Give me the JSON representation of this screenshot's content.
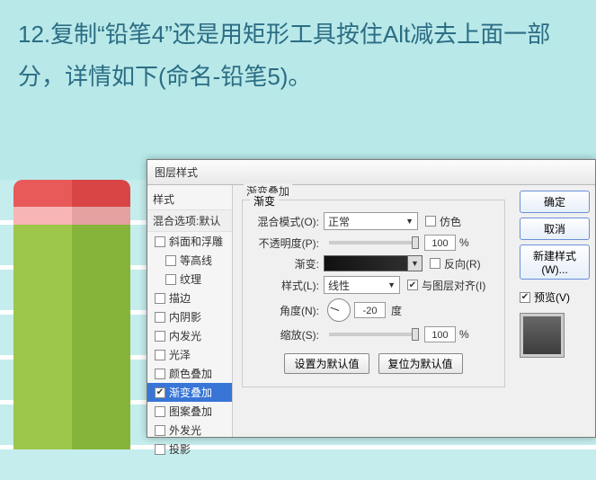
{
  "instruction": "12.复制“铅笔4”还是用矩形工具按住Alt减去上面一部分，详情如下(命名-铅笔5)。",
  "dialog": {
    "title": "图层样式",
    "left": {
      "header": "样式",
      "subheader": "混合选项:默认",
      "items": [
        {
          "label": "斜面和浮雕",
          "checked": false,
          "indent": false
        },
        {
          "label": "等高线",
          "checked": false,
          "indent": true
        },
        {
          "label": "纹理",
          "checked": false,
          "indent": true
        },
        {
          "label": "描边",
          "checked": false,
          "indent": false
        },
        {
          "label": "内阴影",
          "checked": false,
          "indent": false
        },
        {
          "label": "内发光",
          "checked": false,
          "indent": false
        },
        {
          "label": "光泽",
          "checked": false,
          "indent": false
        },
        {
          "label": "颜色叠加",
          "checked": false,
          "indent": false
        },
        {
          "label": "渐变叠加",
          "checked": true,
          "indent": false,
          "selected": true
        },
        {
          "label": "图案叠加",
          "checked": false,
          "indent": false
        },
        {
          "label": "外发光",
          "checked": false,
          "indent": false
        },
        {
          "label": "投影",
          "checked": false,
          "indent": false
        }
      ]
    },
    "group_outer": "渐变叠加",
    "group_inner": "渐变",
    "blend_mode_label": "混合模式(O):",
    "blend_mode_value": "正常",
    "dither_label": "仿色",
    "opacity_label": "不透明度(P):",
    "opacity_value": "100",
    "pct": "%",
    "gradient_label": "渐变:",
    "reverse_label": "反向(R)",
    "style_label": "样式(L):",
    "style_value": "线性",
    "align_label": "与图层对齐(I)",
    "angle_label": "角度(N):",
    "angle_value": "-20",
    "angle_unit": "度",
    "scale_label": "缩放(S):",
    "scale_value": "100",
    "set_default": "设置为默认值",
    "reset_default": "复位为默认值",
    "right": {
      "ok": "确定",
      "cancel": "取消",
      "new_style": "新建样式(W)...",
      "preview": "预览(V)"
    }
  }
}
